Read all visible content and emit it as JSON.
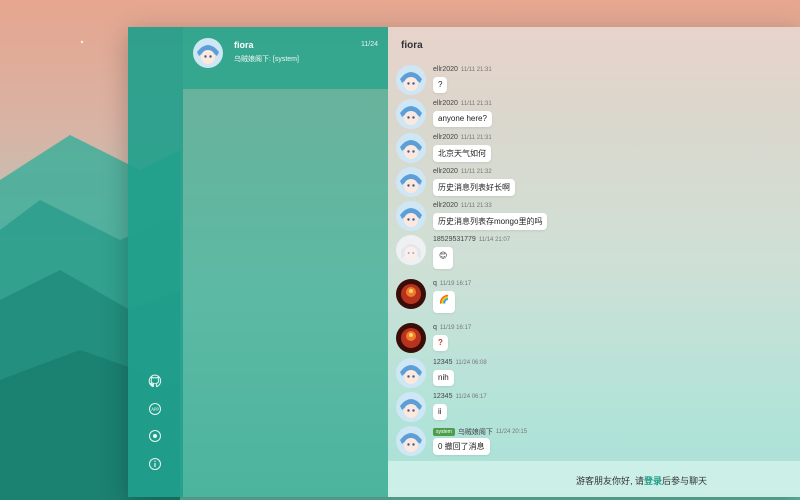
{
  "colors": {
    "toolbar": "#21a08c",
    "sidebar": "#46b49b",
    "accent": "#1f9c86",
    "system_tag": "#4d9e4b"
  },
  "toolbar": {
    "icons": [
      "github-icon",
      "app-icon",
      "settings-icon",
      "info-icon"
    ]
  },
  "linkman": {
    "name": "fiora",
    "time": "11/24",
    "preview": "乌贼娘阁下: [system]"
  },
  "chat": {
    "title": "fiora",
    "messages": [
      {
        "nick": "ellr2020",
        "time": "11/11 21:31",
        "text": "?"
      },
      {
        "nick": "ellr2020",
        "time": "11/11 21:31",
        "text": "anyone here?"
      },
      {
        "nick": "ellr2020",
        "time": "11/11 21:31",
        "text": "北京天气如何"
      },
      {
        "nick": "ellr2020",
        "time": "11/11 21:32",
        "text": "历史消息列表好长啊"
      },
      {
        "nick": "ellr2020",
        "time": "11/11 21:33",
        "text": "历史消息列表存mongo里的吗"
      },
      {
        "nick": "18529531779",
        "time": "11/14 21:07",
        "text": "😊"
      },
      {
        "nick": "q",
        "time": "11/19 16:17",
        "text": "🌈"
      },
      {
        "nick": "q",
        "time": "11/19 16:17",
        "text": "?"
      },
      {
        "nick": "12345",
        "time": "11/24 06:08",
        "text": "nih"
      },
      {
        "nick": "12345",
        "time": "11/24 06:17",
        "text": "ii"
      },
      {
        "tag": "system",
        "nick": "乌贼娘阁下",
        "time": "11/24 20:15",
        "text": "0 撤回了消息"
      }
    ]
  },
  "footer": {
    "guest_prefix": "游客朋友你好, 请",
    "login_link": "登录",
    "guest_suffix": "后参与聊天"
  }
}
